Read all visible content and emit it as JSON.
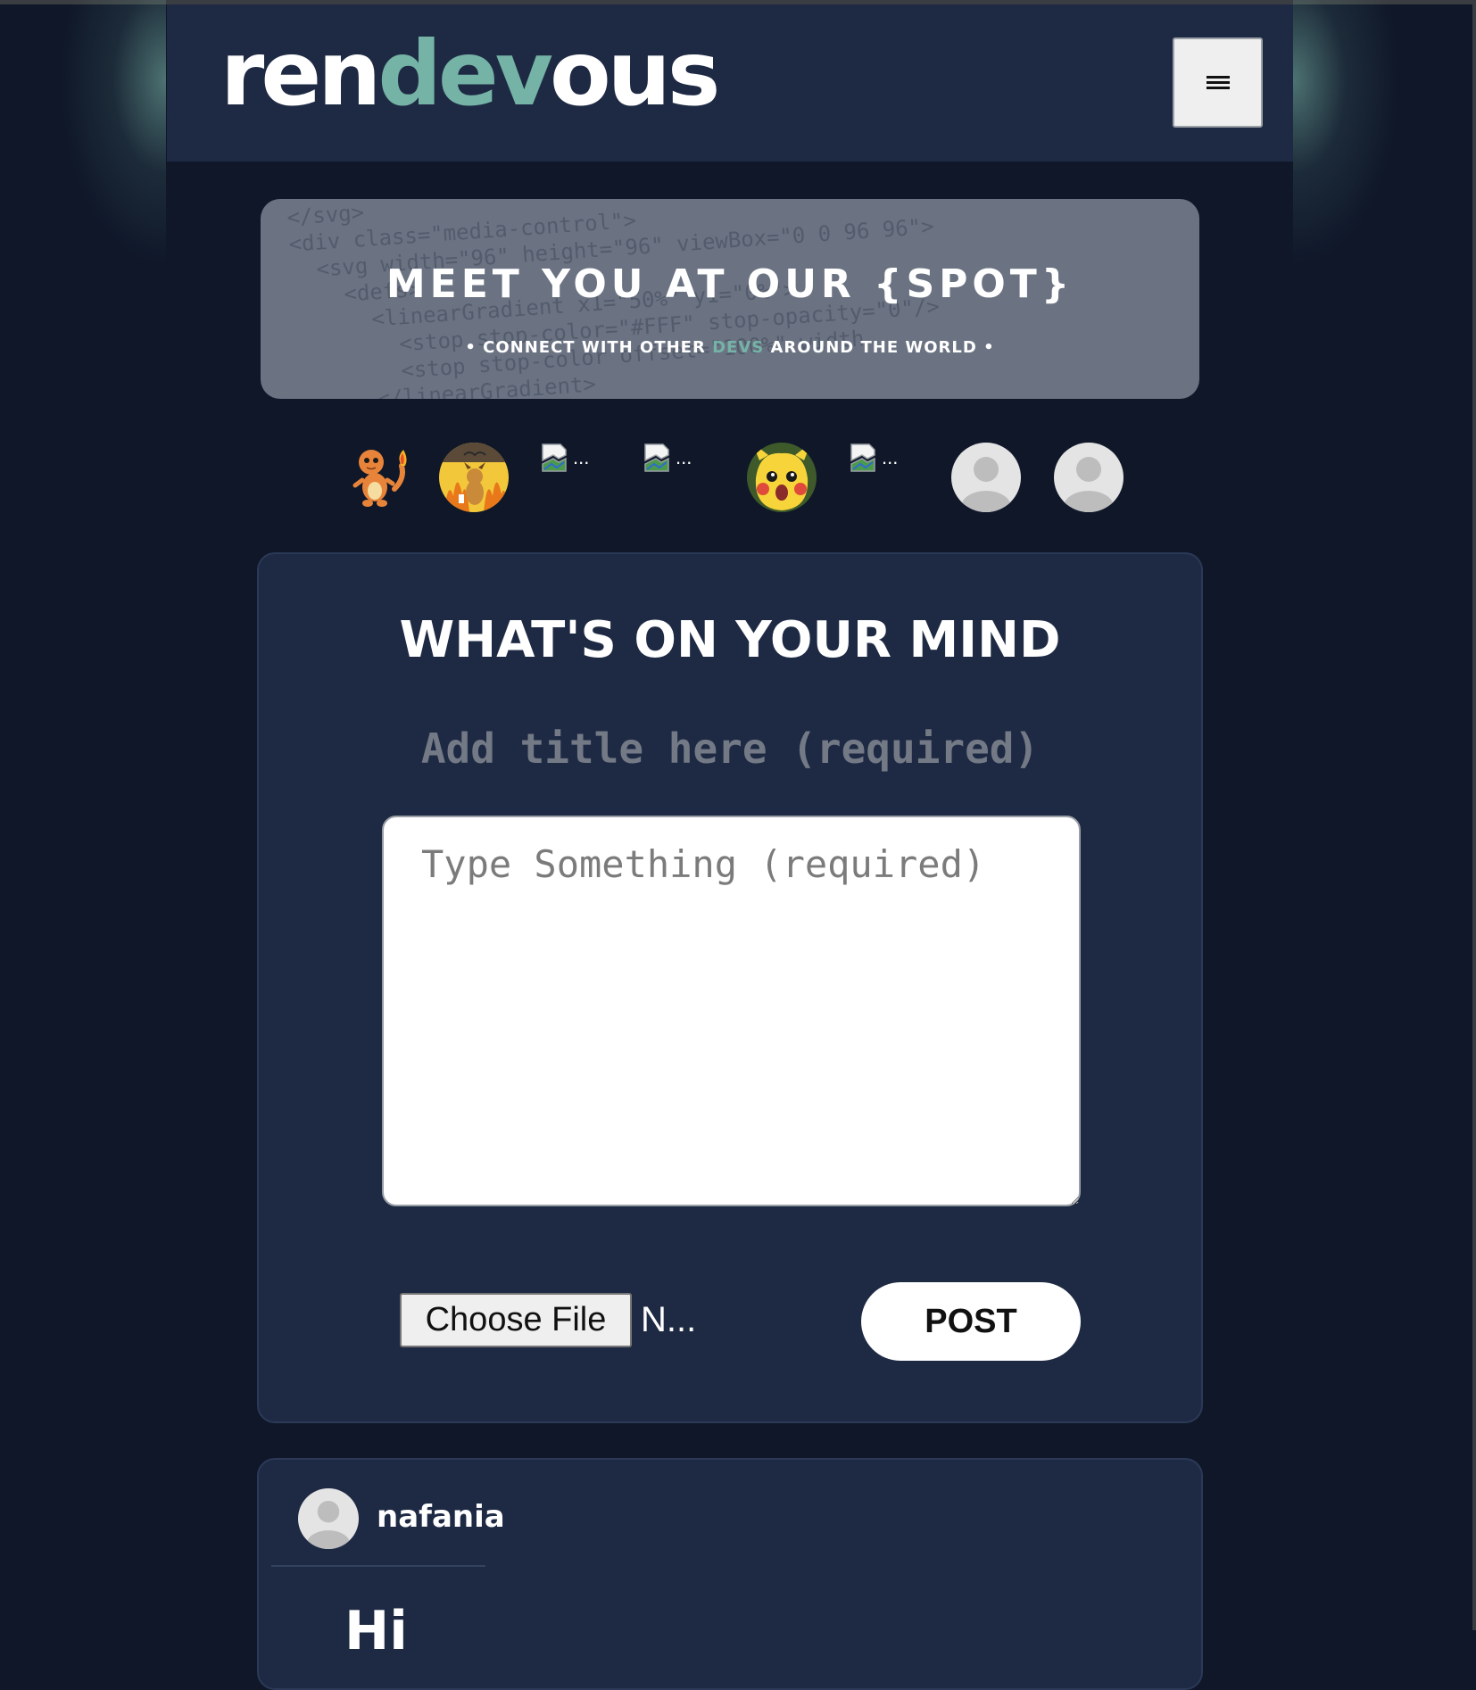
{
  "header": {
    "logo_part1": "ren",
    "logo_accent": "dev",
    "logo_part2": "ous",
    "menu_icon": "hamburger-icon"
  },
  "banner": {
    "heading": "MEET YOU AT OUR {SPOT}",
    "sub_prefix": "• CONNECT WITH OTHER ",
    "sub_accent": "DEVS",
    "sub_suffix": " AROUND THE WORLD •",
    "background_code": "</svg>\n<div class=\"media-control\">\n  <svg width=\"96\" height=\"96\" viewBox=\"0 0 96 96\">\n    <defs>\n      <linearGradient x1=\"50%\" y1=\"0%\">\n        <stop stop-color=\"#FFF\" stop-opacity=\"0\"/>\n        <stop stop-color offset=\"100%\" width\n      </linearGradient>"
  },
  "avatars": [
    {
      "type": "image",
      "icon": "charmander-icon"
    },
    {
      "type": "image",
      "icon": "this-is-fine-dog-icon"
    },
    {
      "type": "broken",
      "icon": "broken-image-icon",
      "text": "..."
    },
    {
      "type": "broken",
      "icon": "broken-image-icon",
      "text": "..."
    },
    {
      "type": "image",
      "icon": "surprised-pikachu-icon"
    },
    {
      "type": "broken",
      "icon": "broken-image-icon",
      "text": "..."
    },
    {
      "type": "default",
      "icon": "default-user-icon"
    },
    {
      "type": "default",
      "icon": "default-user-icon"
    }
  ],
  "compose": {
    "heading": "WHAT'S ON YOUR MIND",
    "title_placeholder": "Add title here (required)",
    "title_value": "",
    "body_placeholder": "Type Something (required)",
    "body_value": "",
    "choose_file_label": "Choose File",
    "file_status": "N...",
    "post_label": "POST"
  },
  "feed": [
    {
      "username": "nafania",
      "body_preview": "Hi",
      "avatar_icon": "default-user-icon"
    }
  ],
  "colors": {
    "page_bg": "#0f1729",
    "card_bg": "#1e2a44",
    "accent": "#75b3a6",
    "banner_bg": "#6b7383"
  }
}
